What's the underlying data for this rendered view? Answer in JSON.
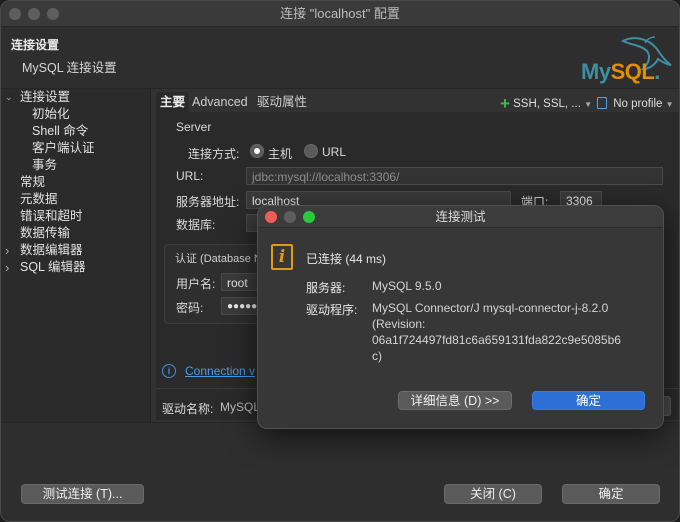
{
  "window": {
    "title": "连接 \"localhost\" 配置"
  },
  "header": {
    "title": "连接设置",
    "subtitle": "MySQL 连接设置",
    "logo_text": "My",
    "logo_accent": "SQL",
    "logo_suffix": "."
  },
  "sidebar": {
    "items": [
      {
        "label": "连接设置",
        "arrow": "⌄"
      },
      {
        "label": "初始化"
      },
      {
        "label": "Shell 命令"
      },
      {
        "label": "客户端认证"
      },
      {
        "label": "事务"
      },
      {
        "label": "常规"
      },
      {
        "label": "元数据"
      },
      {
        "label": "错误和超时"
      },
      {
        "label": "数据传输"
      },
      {
        "label": "数据编辑器",
        "arrow": "›"
      },
      {
        "label": "SQL 编辑器",
        "arrow": "›"
      }
    ]
  },
  "tabs": [
    {
      "label": "主要"
    },
    {
      "label": "Advanced"
    },
    {
      "label": "驱动属性"
    }
  ],
  "toolbar": {
    "ssh_label": "SSH, SSL, ...",
    "profile_label": "No profile"
  },
  "server": {
    "group_label": "Server",
    "connect_by_label": "连接方式:",
    "host_option": "主机",
    "url_option": "URL",
    "url_label": "URL:",
    "url_value": "jdbc:mysql://localhost:3306/",
    "host_label": "服务器地址:",
    "host_value": "localhost",
    "port_label": "端口:",
    "port_value": "3306",
    "database_label": "数据库:"
  },
  "auth": {
    "group_label": "认证 (Database N",
    "user_label": "用户名:",
    "user_value": "root",
    "password_label": "密码:",
    "password_value": "●●●●●"
  },
  "connection_link": "Connection v",
  "driver": {
    "label": "驱动名称:",
    "value": "MySQL"
  },
  "buttons": {
    "test": "测试连接 (T)...",
    "close": "关闭 (C)",
    "ok": "确定"
  },
  "dialog": {
    "title": "连接测试",
    "status": "已连接 (44 ms)",
    "server_label": "服务器:",
    "server_value": "MySQL 9.5.0",
    "driver_label": "驱动程序:",
    "driver_line1": "MySQL Connector/J mysql-connector-j-8.2.0",
    "driver_line2": "(Revision:",
    "driver_line3": "06a1f724497fd81c6a659131fda822c9e5085b6",
    "driver_line4": "c)",
    "details_button": "详细信息 (D) >>",
    "ok_button": "确定"
  },
  "colors": {
    "accent_blue": "#2e6fd6",
    "info_orange": "#e09a14",
    "plus_green": "#3fb94a"
  }
}
